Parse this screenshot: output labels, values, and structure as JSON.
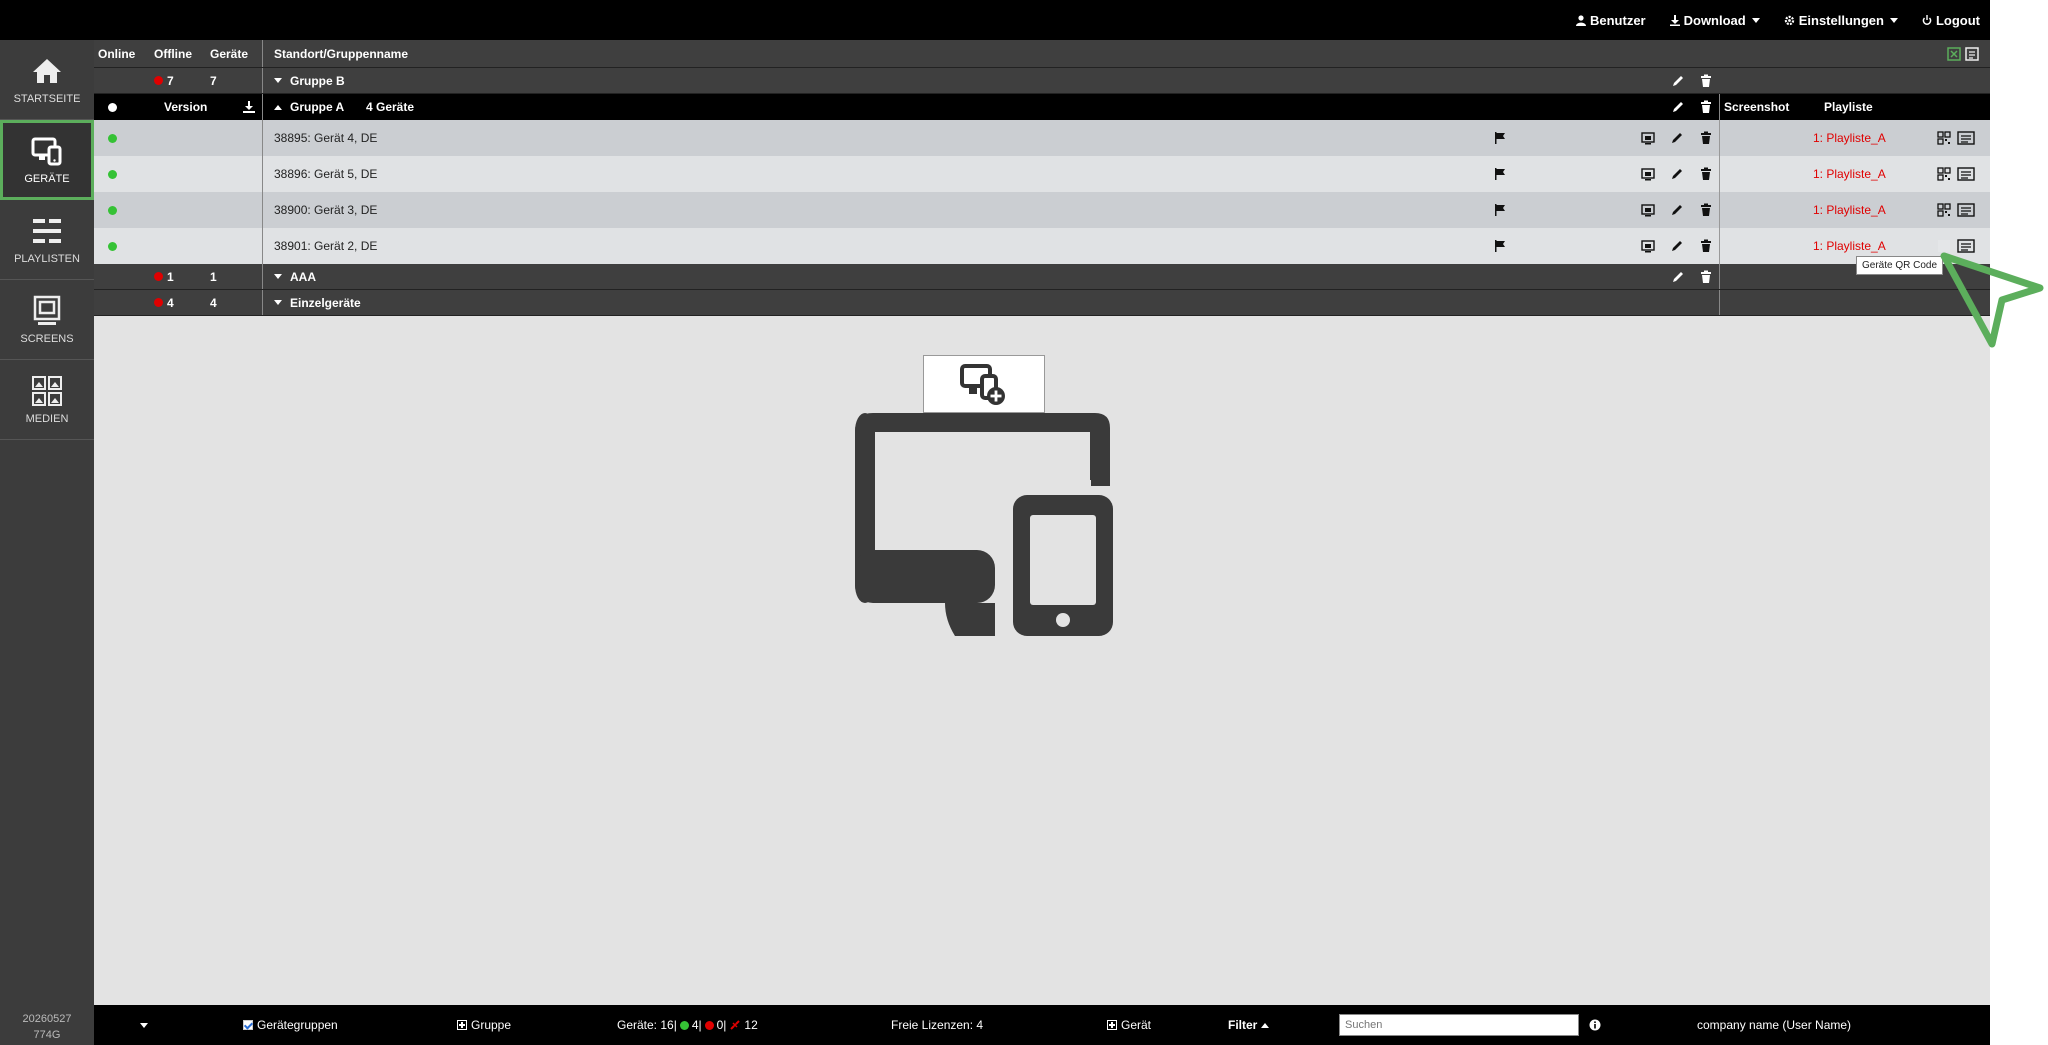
{
  "topnav": {
    "user_label": "Benutzer",
    "download_label": "Download",
    "settings_label": "Einstellungen",
    "logout_label": "Logout"
  },
  "sidebar": {
    "items": [
      {
        "label": "STARTSEITE",
        "icon": "home-icon"
      },
      {
        "label": "GERÄTE",
        "icon": "devices-icon",
        "active": true
      },
      {
        "label": "PLAYLISTEN",
        "icon": "playlist-icon"
      },
      {
        "label": "SCREENS",
        "icon": "screens-icon"
      },
      {
        "label": "MEDIEN",
        "icon": "media-icon"
      }
    ],
    "version_line1": "20260527",
    "version_line2": "774G"
  },
  "table": {
    "headers": {
      "online": "Online",
      "offline": "Offline",
      "devices": "Geräte",
      "location": "Standort/Gruppenname",
      "version": "Version",
      "screenshot": "Screenshot",
      "playlist": "Playliste"
    },
    "group_b": {
      "offline": "7",
      "devices": "7",
      "name": "Gruppe B"
    },
    "group_a": {
      "name": "Gruppe A",
      "count": "4 Geräte"
    },
    "devices": [
      {
        "name": "38895: Gerät 4, DE",
        "playlist": "1: Playliste_A"
      },
      {
        "name": "38896: Gerät 5, DE",
        "playlist": "1: Playliste_A"
      },
      {
        "name": "38900: Gerät 3, DE",
        "playlist": "1: Playliste_A"
      },
      {
        "name": "38901: Gerät 2, DE",
        "playlist": "1: Playliste_A"
      }
    ],
    "group_aaa": {
      "offline": "1",
      "devices": "1",
      "name": "AAA"
    },
    "group_single": {
      "offline": "4",
      "devices": "4",
      "name": "Einzelgeräte"
    }
  },
  "tooltip": "Geräte QR Code",
  "footer": {
    "device_groups_label": "Gerätegruppen",
    "group_label": "Gruppe",
    "stats_prefix": "Geräte: 16|",
    "stats_online": "4|",
    "stats_offline": "0|",
    "stats_other": "12",
    "licenses": "Freie Lizenzen: 4",
    "device_label": "Gerät",
    "filter_label": "Filter",
    "search_placeholder": "Suchen",
    "company": "company name (User Name)"
  },
  "colors": {
    "accent_green": "#5cae5c",
    "online_green": "#35c235",
    "offline_red": "#e00000"
  }
}
